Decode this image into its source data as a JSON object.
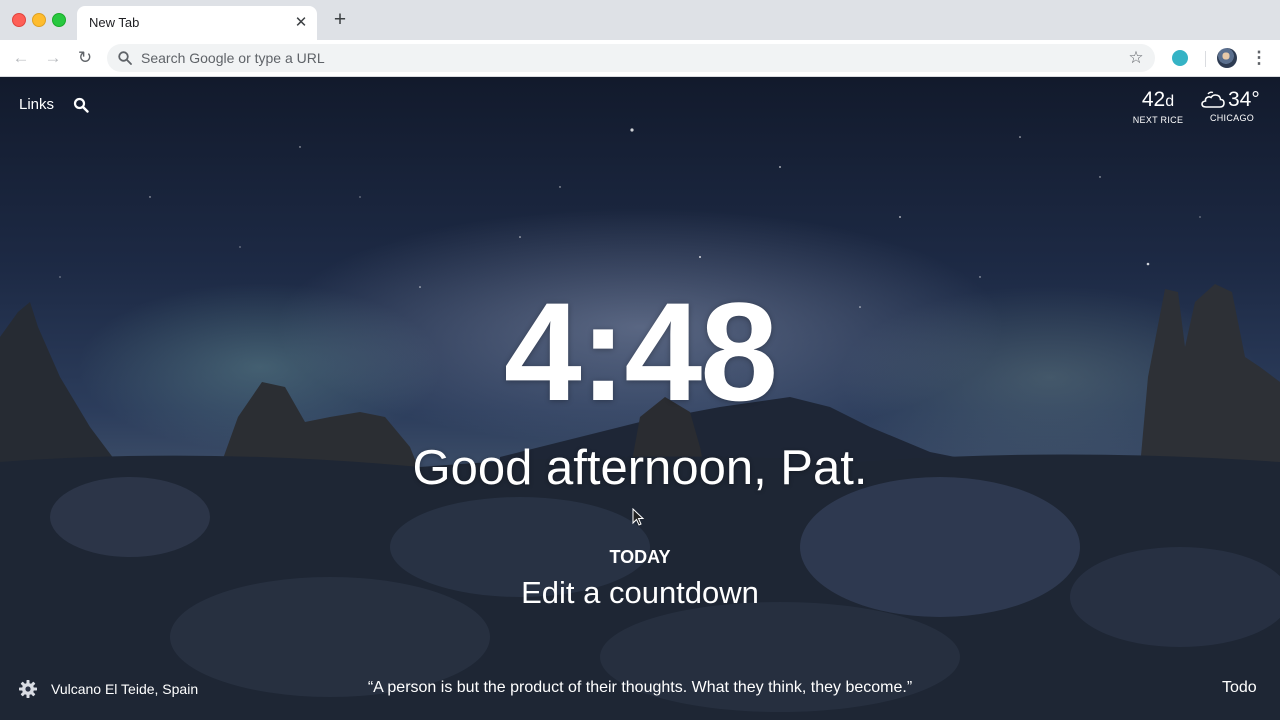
{
  "browser": {
    "tab": {
      "title": "New Tab",
      "close_glyph": "✕"
    },
    "new_tab_glyph": "+",
    "omnibox": {
      "placeholder": "Search Google or type a URL"
    },
    "nav": {
      "back_glyph": "←",
      "forward_glyph": "→",
      "reload_glyph": "↻"
    },
    "star_glyph": "☆",
    "menu_glyph": "⋮",
    "traffic_lights": {
      "close": "#fe5f57",
      "minimize": "#febc2e",
      "maximize": "#28c840"
    }
  },
  "topleft": {
    "links_label": "Links"
  },
  "topright": {
    "countdown": {
      "value": "42",
      "unit": "d",
      "label": "NEXT RICE"
    },
    "weather": {
      "temp": "34°",
      "location": "CHICAGO",
      "icon": "cloud-icon"
    }
  },
  "center": {
    "clock": "4:48",
    "greeting": "Good afternoon, Pat.",
    "today_label": "TODAY",
    "countdown_prompt": "Edit a countdown"
  },
  "footer": {
    "location": "Vulcano El Teide, Spain",
    "quote": "“A person is but the product of their thoughts. What they think, they become.”",
    "todo": "Todo"
  }
}
